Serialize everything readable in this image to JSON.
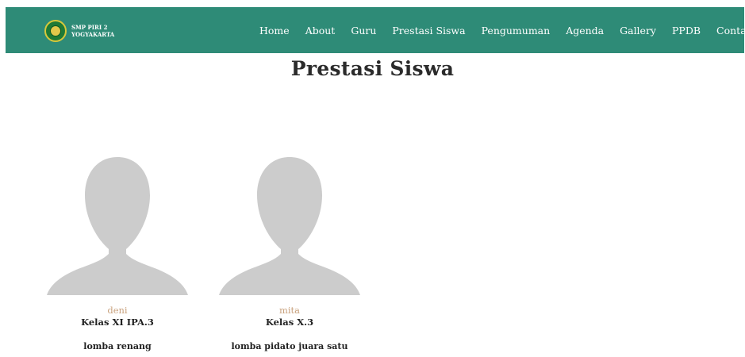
{
  "header": {
    "brand_line1": "SMP PIRI 2",
    "brand_line2": "YOGYAKARTA",
    "bg_color": "#2e8b77"
  },
  "nav": {
    "items": [
      {
        "label": "Home"
      },
      {
        "label": "About"
      },
      {
        "label": "Guru"
      },
      {
        "label": "Prestasi Siswa"
      },
      {
        "label": "Pengumuman"
      },
      {
        "label": "Agenda"
      },
      {
        "label": "Gallery"
      },
      {
        "label": "PPDB"
      },
      {
        "label": "Contact"
      }
    ]
  },
  "main": {
    "title": "Prestasi Siswa",
    "students": [
      {
        "name": "deni",
        "class": "Kelas XI IPA.3",
        "achievement": "lomba renang",
        "avatar_icon": "person-placeholder-icon"
      },
      {
        "name": "mita",
        "class": "Kelas X.3",
        "achievement": "lomba pidato juara satu",
        "avatar_icon": "person-placeholder-icon"
      }
    ],
    "name_color": "#c9a27e"
  }
}
